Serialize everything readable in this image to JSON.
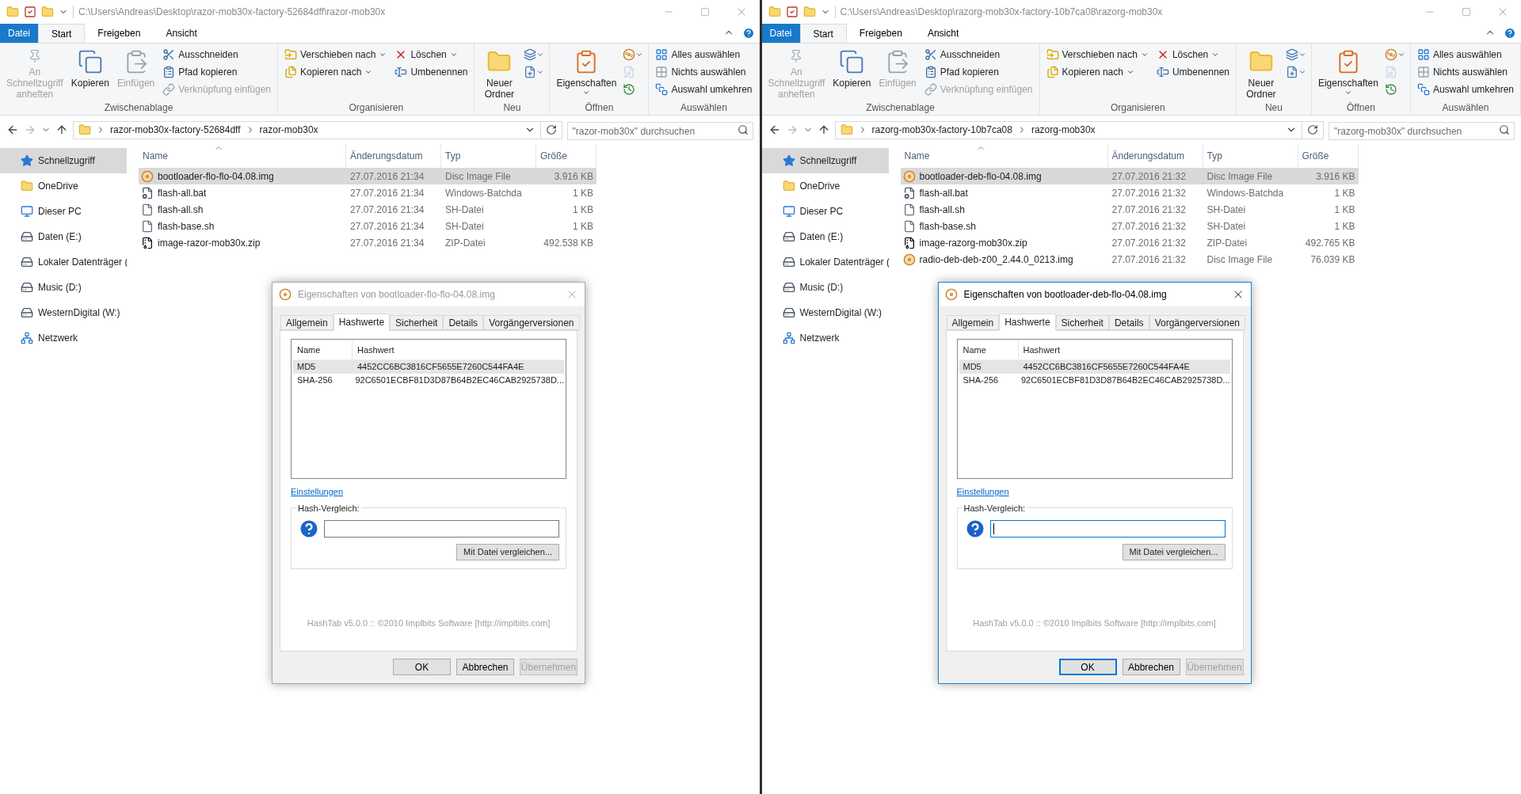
{
  "windows": [
    {
      "title_path": "C:\\Users\\Andreas\\Desktop\\razor-mob30x-factory-52684dff\\razor-mob30x",
      "ribbon_tabs": [
        {
          "label": "Datei",
          "kind": "file",
          "selected": false
        },
        {
          "label": "Start",
          "kind": "tab",
          "selected": true
        },
        {
          "label": "Freigeben",
          "kind": "tab",
          "selected": false
        },
        {
          "label": "Ansicht",
          "kind": "tab",
          "selected": false
        }
      ],
      "ribbon_groups": [
        {
          "title": "Zwischenablage",
          "columns": [
            [
              {
                "label": "An Schnellzugriff anheften",
                "kind": "large",
                "disabled": true,
                "menu": false
              }
            ],
            [
              {
                "label": "Kopieren",
                "kind": "large",
                "disabled": false,
                "menu": false
              }
            ],
            [
              {
                "label": "Einfügen",
                "kind": "large",
                "disabled": true,
                "menu": false
              }
            ],
            [
              {
                "label": "Ausschneiden",
                "kind": "small",
                "disabled": false,
                "menu": false
              },
              {
                "label": "Pfad kopieren",
                "kind": "small",
                "disabled": false,
                "menu": false
              },
              {
                "label": "Verknüpfung einfügen",
                "kind": "small",
                "disabled": true,
                "menu": false
              }
            ]
          ]
        },
        {
          "title": "Organisieren",
          "columns": [
            [
              {
                "label": "Verschieben nach",
                "kind": "small",
                "disabled": false,
                "menu": true
              },
              {
                "label": "Kopieren nach",
                "kind": "small",
                "disabled": false,
                "menu": true
              }
            ],
            [
              {
                "label": "Löschen",
                "kind": "small",
                "disabled": false,
                "menu": true
              },
              {
                "label": "Umbenennen",
                "kind": "small",
                "disabled": false,
                "menu": false
              }
            ]
          ]
        },
        {
          "title": "Neu",
          "columns": [
            [
              {
                "label": "Neuer Ordner",
                "kind": "large",
                "disabled": false,
                "menu": false
              }
            ],
            [
              {
                "kind": "tool",
                "disabled": false,
                "menu": true
              },
              {
                "kind": "tool",
                "disabled": false,
                "menu": true
              }
            ]
          ]
        },
        {
          "title": "Öffnen",
          "columns": [
            [
              {
                "label": "Eigenschaften",
                "kind": "large",
                "disabled": false,
                "menu": true
              }
            ],
            [
              {
                "kind": "tool",
                "disabled": false,
                "menu": true
              },
              {
                "kind": "tool",
                "disabled": true,
                "menu": false
              },
              {
                "kind": "tool",
                "disabled": false,
                "menu": false
              }
            ]
          ]
        },
        {
          "title": "Auswählen",
          "columns": [
            [
              {
                "label": "Alles auswählen",
                "kind": "small",
                "disabled": false,
                "menu": false
              },
              {
                "label": "Nichts auswählen",
                "kind": "small",
                "disabled": false,
                "menu": false
              },
              {
                "label": "Auswahl umkehren",
                "kind": "small",
                "disabled": false,
                "menu": false
              }
            ]
          ]
        }
      ],
      "breadcrumb": [
        "razor-mob30x-factory-52684dff",
        "razor-mob30x"
      ],
      "search": {
        "placeholder": "\"razor-mob30x\" durchsuchen"
      },
      "nav_items": [
        {
          "label": "Schnellzugriff",
          "selected": true
        },
        {
          "label": "OneDrive",
          "selected": false
        },
        {
          "label": "Dieser PC",
          "selected": false
        },
        {
          "label": "Daten (E:)",
          "selected": false
        },
        {
          "label": "Lokaler Datenträger (",
          "selected": false
        },
        {
          "label": "Music (D:)",
          "selected": false
        },
        {
          "label": "WesternDigital (W:)",
          "selected": false
        },
        {
          "label": "Netzwerk",
          "selected": false
        }
      ],
      "columns": [
        "Name",
        "Änderungsdatum",
        "Typ",
        "Größe"
      ],
      "files": [
        {
          "name": "bootloader-flo-flo-04.08.img",
          "date": "27.07.2016 21:34",
          "type": "Disc Image File",
          "size": "3.916 KB",
          "kind": "disc",
          "selected": true
        },
        {
          "name": "flash-all.bat",
          "date": "27.07.2016 21:34",
          "type": "Windows-Batchda",
          "size": "1 KB",
          "kind": "bat",
          "selected": false
        },
        {
          "name": "flash-all.sh",
          "date": "27.07.2016 21:34",
          "type": "SH-Datei",
          "size": "1 KB",
          "kind": "sh",
          "selected": false
        },
        {
          "name": "flash-base.sh",
          "date": "27.07.2016 21:34",
          "type": "SH-Datei",
          "size": "1 KB",
          "kind": "sh",
          "selected": false
        },
        {
          "name": "image-razor-mob30x.zip",
          "date": "27.07.2016 21:34",
          "type": "ZIP-Datei",
          "size": "492.538 KB",
          "kind": "zip",
          "selected": false
        }
      ],
      "dialog": {
        "title": "Eigenschaften von bootloader-flo-flo-04.08.img",
        "active": false,
        "tabs": [
          {
            "label": "Allgemein",
            "selected": false
          },
          {
            "label": "Hashwerte",
            "selected": true
          },
          {
            "label": "Sicherheit",
            "selected": false
          },
          {
            "label": "Details",
            "selected": false
          },
          {
            "label": "Vorgängerversionen",
            "selected": false
          }
        ],
        "hash_columns": [
          "Name",
          "Hashwert"
        ],
        "hashes": [
          {
            "name": "MD5",
            "value": "4452CC6BC3816CF5655E7260C544FA4E",
            "selected": true
          },
          {
            "name": "SHA-256",
            "value": "92C6501ECBF81D3D87B64B2EC46CAB2925738D...",
            "selected": false
          }
        ],
        "settings_link": "Einstellungen",
        "compare_label": "Hash-Vergleich:",
        "compare_focused": false,
        "compare_button": "Mit Datei vergleichen...",
        "footer": "HashTab v5.0.0 :: ©2010 Implbits Software [http://implbits.com]",
        "buttons": [
          {
            "label": "OK",
            "default": false,
            "disabled": false
          },
          {
            "label": "Abbrechen",
            "default": false,
            "disabled": false
          },
          {
            "label": "Übernehmen",
            "default": false,
            "disabled": true
          }
        ]
      }
    },
    {
      "title_path": "C:\\Users\\Andreas\\Desktop\\razorg-mob30x-factory-10b7ca08\\razorg-mob30x",
      "ribbon_tabs": [
        {
          "label": "Datei",
          "kind": "file",
          "selected": false
        },
        {
          "label": "Start",
          "kind": "tab",
          "selected": true
        },
        {
          "label": "Freigeben",
          "kind": "tab",
          "selected": false
        },
        {
          "label": "Ansicht",
          "kind": "tab",
          "selected": false
        }
      ],
      "ribbon_groups": [
        {
          "title": "Zwischenablage",
          "columns": [
            [
              {
                "label": "An Schnellzugriff anheften",
                "kind": "large",
                "disabled": true,
                "menu": false
              }
            ],
            [
              {
                "label": "Kopieren",
                "kind": "large",
                "disabled": false,
                "menu": false
              }
            ],
            [
              {
                "label": "Einfügen",
                "kind": "large",
                "disabled": true,
                "menu": false
              }
            ],
            [
              {
                "label": "Ausschneiden",
                "kind": "small",
                "disabled": false,
                "menu": false
              },
              {
                "label": "Pfad kopieren",
                "kind": "small",
                "disabled": false,
                "menu": false
              },
              {
                "label": "Verknüpfung einfügen",
                "kind": "small",
                "disabled": true,
                "menu": false
              }
            ]
          ]
        },
        {
          "title": "Organisieren",
          "columns": [
            [
              {
                "label": "Verschieben nach",
                "kind": "small",
                "disabled": false,
                "menu": true
              },
              {
                "label": "Kopieren nach",
                "kind": "small",
                "disabled": false,
                "menu": true
              }
            ],
            [
              {
                "label": "Löschen",
                "kind": "small",
                "disabled": false,
                "menu": true
              },
              {
                "label": "Umbenennen",
                "kind": "small",
                "disabled": false,
                "menu": false
              }
            ]
          ]
        },
        {
          "title": "Neu",
          "columns": [
            [
              {
                "label": "Neuer Ordner",
                "kind": "large",
                "disabled": false,
                "menu": false
              }
            ],
            [
              {
                "kind": "tool",
                "disabled": false,
                "menu": true
              },
              {
                "kind": "tool",
                "disabled": false,
                "menu": true
              }
            ]
          ]
        },
        {
          "title": "Öffnen",
          "columns": [
            [
              {
                "label": "Eigenschaften",
                "kind": "large",
                "disabled": false,
                "menu": true
              }
            ],
            [
              {
                "kind": "tool",
                "disabled": false,
                "menu": true
              },
              {
                "kind": "tool",
                "disabled": true,
                "menu": false
              },
              {
                "kind": "tool",
                "disabled": false,
                "menu": false
              }
            ]
          ]
        },
        {
          "title": "Auswählen",
          "columns": [
            [
              {
                "label": "Alles auswählen",
                "kind": "small",
                "disabled": false,
                "menu": false
              },
              {
                "label": "Nichts auswählen",
                "kind": "small",
                "disabled": false,
                "menu": false
              },
              {
                "label": "Auswahl umkehren",
                "kind": "small",
                "disabled": false,
                "menu": false
              }
            ]
          ]
        }
      ],
      "breadcrumb": [
        "razorg-mob30x-factory-10b7ca08",
        "razorg-mob30x"
      ],
      "search": {
        "placeholder": "\"razorg-mob30x\" durchsuchen"
      },
      "nav_items": [
        {
          "label": "Schnellzugriff",
          "selected": true
        },
        {
          "label": "OneDrive",
          "selected": false
        },
        {
          "label": "Dieser PC",
          "selected": false
        },
        {
          "label": "Daten (E:)",
          "selected": false
        },
        {
          "label": "Lokaler Datenträger (",
          "selected": false
        },
        {
          "label": "Music (D:)",
          "selected": false
        },
        {
          "label": "WesternDigital (W:)",
          "selected": false
        },
        {
          "label": "Netzwerk",
          "selected": false
        }
      ],
      "columns": [
        "Name",
        "Änderungsdatum",
        "Typ",
        "Größe"
      ],
      "files": [
        {
          "name": "bootloader-deb-flo-04.08.img",
          "date": "27.07.2016 21:32",
          "type": "Disc Image File",
          "size": "3.916 KB",
          "kind": "disc",
          "selected": true
        },
        {
          "name": "flash-all.bat",
          "date": "27.07.2016 21:32",
          "type": "Windows-Batchda",
          "size": "1 KB",
          "kind": "bat",
          "selected": false
        },
        {
          "name": "flash-all.sh",
          "date": "27.07.2016 21:32",
          "type": "SH-Datei",
          "size": "1 KB",
          "kind": "sh",
          "selected": false
        },
        {
          "name": "flash-base.sh",
          "date": "27.07.2016 21:32",
          "type": "SH-Datei",
          "size": "1 KB",
          "kind": "sh",
          "selected": false
        },
        {
          "name": "image-razorg-mob30x.zip",
          "date": "27.07.2016 21:32",
          "type": "ZIP-Datei",
          "size": "492.765 KB",
          "kind": "zip",
          "selected": false
        },
        {
          "name": "radio-deb-deb-z00_2.44.0_0213.img",
          "date": "27.07.2016 21:32",
          "type": "Disc Image File",
          "size": "76.039 KB",
          "kind": "disc",
          "selected": false
        }
      ],
      "dialog": {
        "title": "Eigenschaften von bootloader-deb-flo-04.08.img",
        "active": true,
        "tabs": [
          {
            "label": "Allgemein",
            "selected": false
          },
          {
            "label": "Hashwerte",
            "selected": true
          },
          {
            "label": "Sicherheit",
            "selected": false
          },
          {
            "label": "Details",
            "selected": false
          },
          {
            "label": "Vorgängerversionen",
            "selected": false
          }
        ],
        "hash_columns": [
          "Name",
          "Hashwert"
        ],
        "hashes": [
          {
            "name": "MD5",
            "value": "4452CC6BC3816CF5655E7260C544FA4E",
            "selected": true
          },
          {
            "name": "SHA-256",
            "value": "92C6501ECBF81D3D87B64B2EC46CAB2925738D...",
            "selected": false
          }
        ],
        "settings_link": "Einstellungen",
        "compare_label": "Hash-Vergleich:",
        "compare_focused": true,
        "compare_button": "Mit Datei vergleichen...",
        "footer": "HashTab v5.0.0 :: ©2010 Implbits Software [http://implbits.com]",
        "buttons": [
          {
            "label": "OK",
            "default": true,
            "disabled": false
          },
          {
            "label": "Abbrechen",
            "default": false,
            "disabled": false
          },
          {
            "label": "Übernehmen",
            "default": false,
            "disabled": true
          }
        ]
      }
    }
  ]
}
